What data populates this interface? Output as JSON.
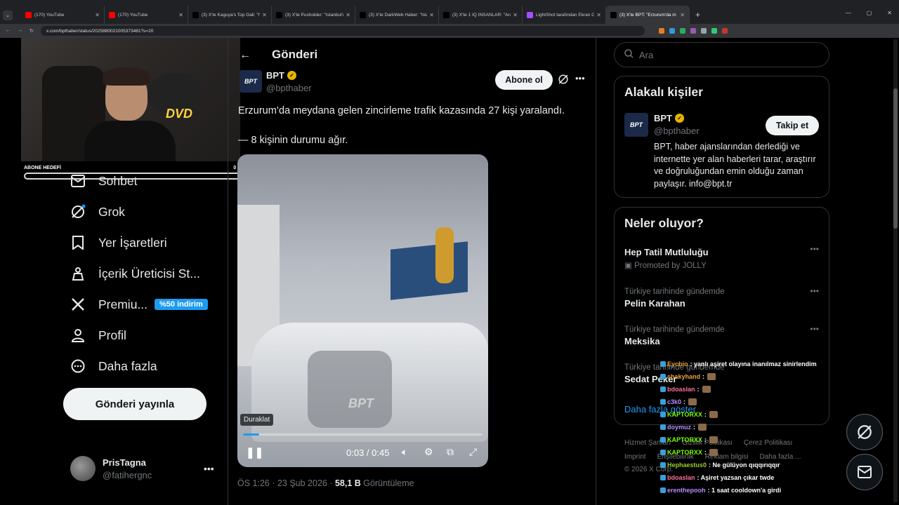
{
  "browser": {
    "tabs": [
      {
        "title": "(170) YouTube",
        "color": "#ff0000",
        "icon": "youtube-icon"
      },
      {
        "title": "(170) YouTube",
        "color": "#ff0000",
        "icon": "youtube-icon"
      },
      {
        "title": "(3) X'te Kaguya's Top Gali: \"http:",
        "color": "#000000",
        "icon": "x-icon"
      },
      {
        "title": "(3) X'te Pusholder: \"İstanbul'da",
        "color": "#000000",
        "icon": "x-icon"
      },
      {
        "title": "(3) X'te DarkWeb Haber: \"İstanb",
        "color": "#000000",
        "icon": "x-icon"
      },
      {
        "title": "(3) X'te 1 IQ İNSANLAR: \"Araba",
        "color": "#000000",
        "icon": "x-icon"
      },
      {
        "title": "LightShot tarafından Ekran Görü",
        "color": "#a64dff",
        "icon": "lightshot-icon"
      },
      {
        "title": "(3) X'te BPT: \"Erzurum'da m",
        "color": "#000000",
        "icon": "x-icon",
        "active": true
      }
    ],
    "url": "x.com/bpthaber/status/2025880021005373481?s=20"
  },
  "stream": {
    "goal_label": "ABONE HEDEFİ",
    "goal_value": "0 / 1",
    "dvd_text": "DVD"
  },
  "sidebar": {
    "items": [
      {
        "label": "Sohbet",
        "icon": "mail-icon"
      },
      {
        "label": "Grok",
        "icon": "grok-icon"
      },
      {
        "label": "Yer İşaretleri",
        "icon": "bookmark-icon"
      },
      {
        "label": "İçerik Üreticisi St...",
        "icon": "creator-studio-icon"
      },
      {
        "label": "Premiu...",
        "icon": "x-logo-icon",
        "badge": "%50 indirim"
      },
      {
        "label": "Profil",
        "icon": "profile-icon"
      },
      {
        "label": "Daha fazla",
        "icon": "more-circle-icon"
      }
    ],
    "post_button": "Gönderi yayınla",
    "user": {
      "name": "PrisTagna",
      "handle": "@fatihergnc"
    }
  },
  "post": {
    "header": "Gönderi",
    "author_name": "BPT",
    "author_handle": "@bpthaber",
    "subscribe": "Abone ol",
    "text_line1": "Erzurum’da meydana gelen zincirleme trafik kazasında 27 kişi yaralandı.",
    "text_line2": "— 8 kişinin durumu ağır.",
    "video": {
      "watermark": "BPT",
      "tooltip": "Duraklat",
      "time": "0:03 / 0:45",
      "progress": 0.067
    },
    "meta_time": "ÖS 1:26 · 23 Şub 2026 · ",
    "views": "58,1 B",
    "views_label": " Görüntüleme"
  },
  "right": {
    "search_placeholder": "Ara",
    "related_title": "Alakalı kişiler",
    "related": {
      "name": "BPT",
      "handle": "@bpthaber",
      "follow": "Takip et",
      "bio": "BPT, haber ajanslarından derlediği ve internette yer alan haberleri tarar, araştırır ve doğruluğundan emin olduğu zaman paylaşır. info@bpt.tr"
    },
    "trends_title": "Neler oluyor?",
    "trends": [
      {
        "context": "",
        "name": "Hep Tatil Mutluluğu",
        "promo": "Promoted by JOLLY"
      },
      {
        "context": "Türkiye tarihinde gündemde",
        "name": "Pelin Karahan"
      },
      {
        "context": "Türkiye tarihinde gündemde",
        "name": "Meksika"
      },
      {
        "context": "Türkiye tarihinde gündemde",
        "name": "Sedat Peker"
      }
    ],
    "show_more": "Daha fazla göster",
    "footer_row1": [
      "Hizmet Şartları",
      "Gizlilik Politikası",
      "Çerez Politikası"
    ],
    "footer_row2": [
      "Imprint",
      "Erişilebilirlik",
      "Reklam bilgisi",
      "Daha fazla ..."
    ],
    "copyright": "© 2026 X Corp."
  },
  "chat": [
    {
      "user": "Eycbio",
      "msg": ": yanlı aşiret olayına inanılmaz sinirlendim",
      "color": "#e8a23c"
    },
    {
      "user": "shakyhand",
      "msg": ":",
      "color": "#e8a23c",
      "emote": true
    },
    {
      "user": "bdoaslan",
      "msg": ":",
      "color": "#ff6fa0",
      "emote": true
    },
    {
      "user": "c3k0",
      "msg": ":",
      "color": "#b78cff",
      "emote": true
    },
    {
      "user": "KAPTORXX",
      "msg": ":",
      "color": "#7cfc00",
      "emote": true
    },
    {
      "user": "doymuz",
      "msg": ":",
      "color": "#b78cff",
      "emote": true
    },
    {
      "user": "KAPTORXX",
      "msg": ":",
      "color": "#7cfc00",
      "emote": true
    },
    {
      "user": "KAPTORXX",
      "msg": ":",
      "color": "#7cfc00",
      "emote": true
    },
    {
      "user": "Hephaestus0",
      "msg": ": Ne gülüyon qıqqırıqqır",
      "color": "#9acd32"
    },
    {
      "user": "bdoaslan",
      "msg": ": Aşiret yazsan çıkar twde",
      "color": "#ff6fa0"
    },
    {
      "user": "erenthepooh",
      "msg": ": 1 saat cooldown'a girdi",
      "color": "#b78cff"
    }
  ]
}
